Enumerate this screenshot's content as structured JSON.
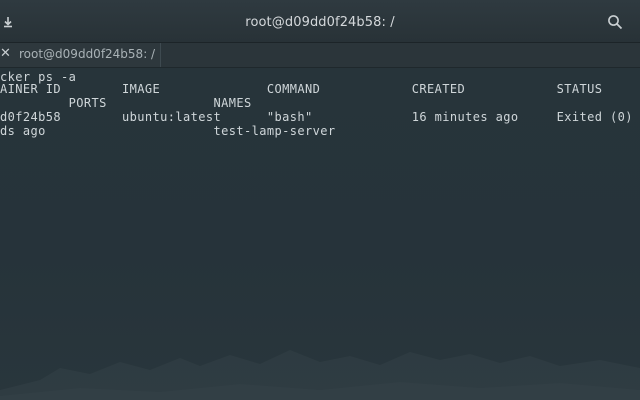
{
  "window": {
    "title": "root@d09dd0f24b58: /"
  },
  "tabs": [
    {
      "label": "root@d09dd0f24b58: /"
    }
  ],
  "terminal": {
    "lines": [
      "cker ps -a",
      "AINER ID        IMAGE              COMMAND            CREATED            STATUS",
      "         PORTS              NAMES",
      "d0f24b58        ubuntu:latest      \"bash\"             16 minutes ago     Exited (0)",
      "ds ago                      test-lamp-server"
    ]
  }
}
